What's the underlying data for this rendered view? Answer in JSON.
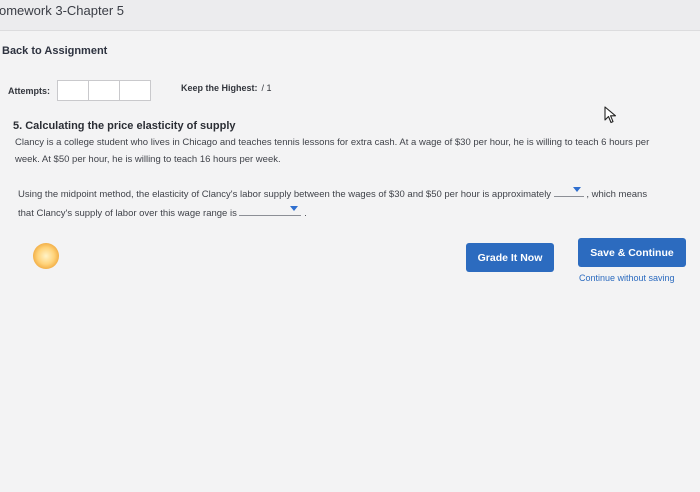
{
  "header": {
    "title": "omework 3-Chapter 5"
  },
  "nav": {
    "back_label": "Back to Assignment"
  },
  "attempts": {
    "label": "Attempts:",
    "keep_label": "Keep the Highest:",
    "keep_value": "/ 1"
  },
  "question": {
    "title": "5. Calculating the price elasticity of supply",
    "body_line1": "Clancy is a college student who lives in Chicago and teaches tennis lessons for extra cash. At a wage of $30 per hour, he is willing to teach 6 hours per",
    "body_line2": "week. At $50 per hour, he is willing to teach 16 hours per week.",
    "prompt_part1": "Using the midpoint method, the elasticity of Clancy's labor supply between the wages of $30 and $50 per hour is approximately",
    "prompt_part2": ", which means",
    "prompt_part3": "that Clancy's supply of labor over this wage range is",
    "prompt_end": "."
  },
  "buttons": {
    "grade_label": "Grade It Now",
    "save_label": "Save & Continue",
    "continue_label": "Continue without saving"
  },
  "colors": {
    "button_blue": "#2c6bbf",
    "dropdown_arrow": "#2f6fcf",
    "highlight": "#f3b14a"
  },
  "icons": {
    "cursor": "mouse-pointer-icon",
    "dropdown": "triangle-down-icon"
  }
}
